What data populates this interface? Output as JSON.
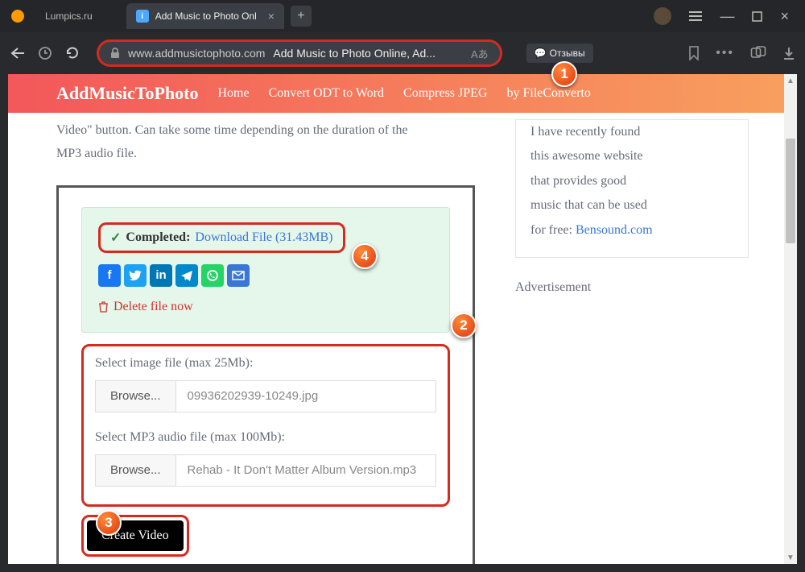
{
  "browser": {
    "tab1_label": "Lumpics.ru",
    "tab2_label": "Add Music to Photo Onl",
    "url_domain": "www.addmusictophoto.com",
    "url_title": "Add Music to Photo Online, Ad...",
    "reviews_label": "Отзывы"
  },
  "site_nav": {
    "logo": "AddMusicToPhoto",
    "home": "Home",
    "convert": "Convert ODT to Word",
    "compress": "Compress JPEG",
    "by": "by FileConverto"
  },
  "intro": {
    "line1": "Video\" button. Can take some time depending on the duration of the",
    "line2": "MP3 audio file."
  },
  "completed": {
    "label": "Completed:",
    "link": "Download File (31.43MB)"
  },
  "delete_label": "Delete file now",
  "form": {
    "image_label": "Select image file (max 25Mb):",
    "browse": "Browse...",
    "image_file": "09936202939-10249.jpg",
    "audio_label": "Select MP3 audio file (max 100Mb):",
    "audio_file": "Rehab - It Don't Matter Album Version.mp3",
    "create": "Create Video"
  },
  "sidebar": {
    "text1": "I have recently found",
    "text2": "this awesome website",
    "text3": "that provides good",
    "text4": "music that can be used",
    "text5": "for free: ",
    "link": "Bensound.com",
    "advert": "Advertisement"
  },
  "badges": {
    "b1": "1",
    "b2": "2",
    "b3": "3",
    "b4": "4"
  }
}
